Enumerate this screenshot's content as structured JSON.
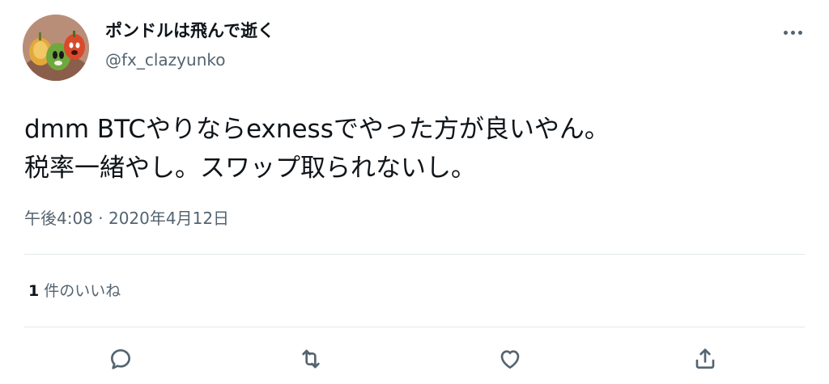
{
  "author": {
    "display_name": "ポンドルは飛んで逝く",
    "handle": "@fx_clazyunko"
  },
  "tweet": {
    "lines": [
      "dmm BTCやりならexnessでやった方が良いやん。",
      "税率一緒やし。スワップ取られないし。"
    ],
    "timestamp": "午後4:08 · 2020年4月12日"
  },
  "stats": {
    "like_count": "1",
    "like_label": "件のいいね"
  },
  "icons": {
    "more": "more-horizontal-icon",
    "reply": "reply-icon",
    "retweet": "retweet-icon",
    "like": "heart-icon",
    "share": "share-icon"
  },
  "colors": {
    "text_primary": "#0f1419",
    "text_secondary": "#536471",
    "divider": "#e1e8ed"
  }
}
